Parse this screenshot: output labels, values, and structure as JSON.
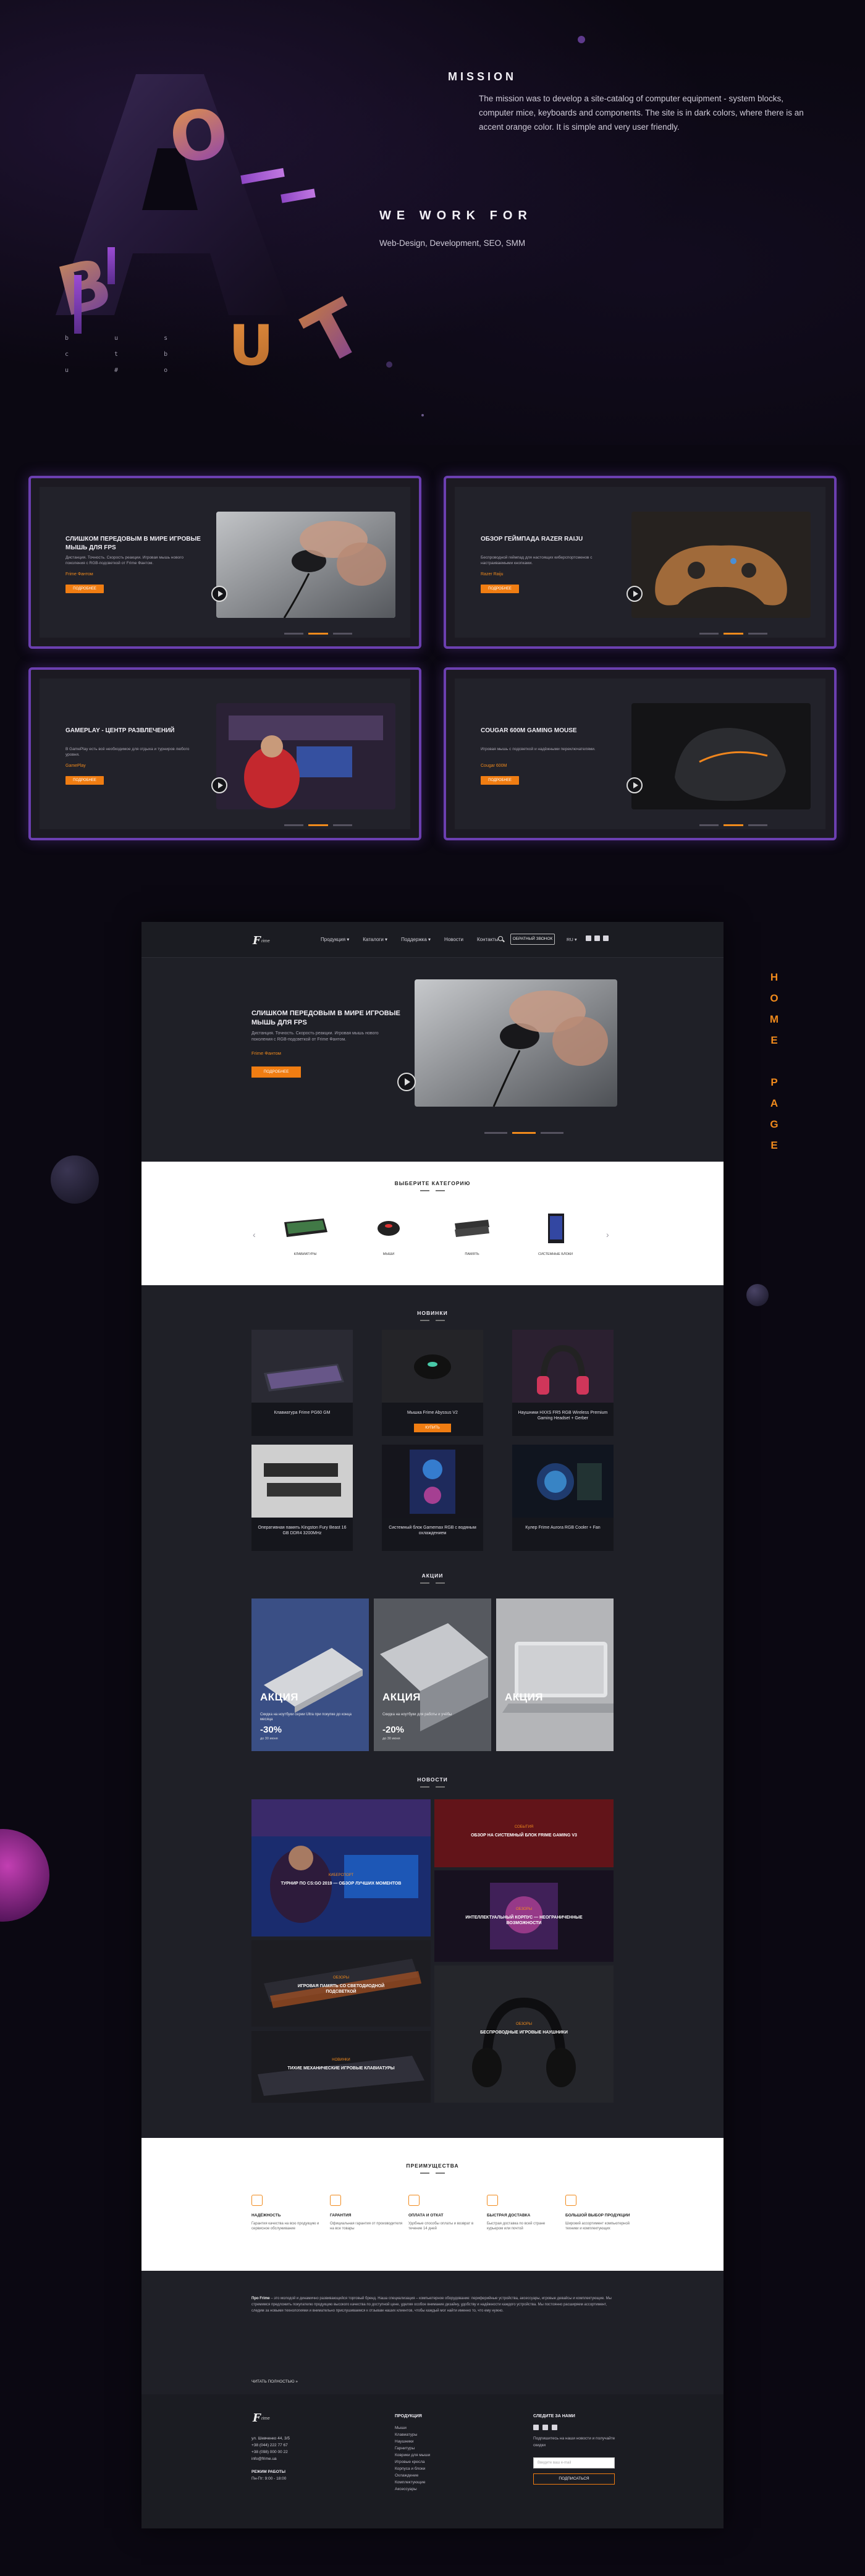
{
  "about": {
    "letters": {
      "o": "O",
      "b": "B",
      "u": "U",
      "t": "T",
      "a": "A"
    },
    "grid": [
      "b u s",
      "c t b",
      "u # o"
    ],
    "mission_title": "MISSION",
    "mission_text": "The mission was to develop a site-catalog of computer equipment - system blocks, computer mice, keyboards and components. The site is in dark colors, where there is an accent orange color. It is simple and very user friendly.",
    "work_title": "WE WORK FOR",
    "work_text": "Web-Design, Development, SEO, SMM"
  },
  "variants": [
    {
      "title": "СЛИШКОМ ПЕРЕДОВЫМ В МИРЕ ИГРОВЫЕ МЫШЬ ДЛЯ FPS",
      "desc": "Дистанция. Точность. Скорость реакции. Игровая мышь нового поколения с RGB-подсветкой от Frime Фантом.",
      "link": "Frime Фантом",
      "button": "ПОДРОБНЕЕ"
    },
    {
      "title": "ОБЗОР ГЕЙМПАДА RAZER RAIJU",
      "desc": "Беспроводной геймпад для настоящих киберспортсменов с настраиваемыми кнопками.",
      "link": "Razer Raiju",
      "button": "ПОДРОБНЕЕ"
    },
    {
      "title": "GAMEPLAY - ЦЕНТР РАЗВЛЕЧЕНИЙ",
      "desc": "В GamePlay есть всё необходимое для отдыха и турниров любого уровня.",
      "link": "GamePlay",
      "button": "ПОДРОБНЕЕ"
    },
    {
      "title": "COUGAR 600M GAMING MOUSE",
      "desc": "Игровая мышь с подсветкой и надёжными переключателями.",
      "link": "Cougar 600M",
      "button": "ПОДРОБНЕЕ"
    }
  ],
  "home_label": [
    "H",
    "O",
    "M",
    "E",
    "",
    "P",
    "A",
    "G",
    "E"
  ],
  "site": {
    "nav": {
      "logo": "F",
      "logo_word": "rime",
      "links": [
        "Продукция ▾",
        "Каталоги ▾",
        "Поддержка ▾",
        "Новости",
        "Контакты"
      ],
      "cta": "ОБРАТНЫЙ ЗВОНОК",
      "lang": "RU ▾"
    },
    "hero": {
      "title": "СЛИШКОМ ПЕРЕДОВЫМ В МИРЕ ИГРОВЫЕ МЫШЬ ДЛЯ FPS",
      "desc": "Дистанция. Точность. Скорость реакции. Игровая мышь нового поколения с RGB-подсветкой от Frime Фантом.",
      "link": "Frime Фантом",
      "button": "ПОДРОБНЕЕ"
    },
    "categories": {
      "title": "ВЫБЕРИТЕ КАТЕГОРИЮ",
      "items": [
        "КЛАВИАТУРЫ",
        "МЫШИ",
        "ПАМЯТЬ",
        "СИСТЕМНЫЕ БЛОКИ"
      ]
    },
    "novelty": {
      "title": "НОВИНКИ",
      "items": [
        "Клавиатура Frime PG60 GM",
        "Мышка Frime Abyssus V2",
        "Наушники HXXS FR5 RGB Wireless Premium Gaming Headset + Gerber",
        "Оперативная память Kingston Fury Beast 16 GB DDR4 3200MHz",
        "Системный блок Gamemax RGB с водяным охлаждением",
        "Кулер Frime Aurora RGB Cooler + Fan"
      ],
      "button": "КУПИТЬ"
    },
    "promos": {
      "title": "АКЦИИ",
      "items": [
        {
          "label": "АКЦИЯ",
          "sub": "Скидка на ноутбуки серии Ultra при покупке до конца месяца",
          "pct": "-30%",
          "date": "до 30 июня"
        },
        {
          "label": "АКЦИЯ",
          "sub": "Скидка на ноутбуки для работы и учёбы",
          "pct": "-20%",
          "date": "до 30 июня"
        },
        {
          "label": "АКЦИЯ",
          "sub": "",
          "pct": "",
          "date": ""
        }
      ]
    },
    "news": {
      "title": "НОВОСТИ",
      "items": [
        {
          "tag": "КИБЕРСПОРТ",
          "cap": "ТУРНИР ПО CS:GO 2019 — ОБЗОР ЛУЧШИХ МОМЕНТОВ"
        },
        {
          "tag": "СОБЫТИЯ",
          "cap": "ОБЗОР НА СИСТЕМНЫЙ БЛОК FRIME GAMING V3"
        },
        {
          "tag": "ОБЗОРЫ",
          "cap": "ИНТЕЛЛЕКТУАЛЬНЫЙ КОРПУС — НЕОГРАНИЧЕННЫЕ ВОЗМОЖНОСТИ"
        },
        {
          "tag": "ОБЗОРЫ",
          "cap": "ИГРОВАЯ ПАМЯТЬ СО СВЕТОДИОДНОЙ ПОДСВЕТКОЙ"
        },
        {
          "tag": "ОБЗОРЫ",
          "cap": "БЕСПРОВОДНЫЕ ИГРОВЫЕ НАУШНИКИ"
        },
        {
          "tag": "НОВИНКИ",
          "cap": "ТИХИЕ МЕХАНИЧЕСКИЕ ИГРОВЫЕ КЛАВИАТУРЫ"
        }
      ]
    },
    "advantages": {
      "title": "ПРЕИМУЩЕСТВА",
      "items": [
        {
          "title": "НАДЁЖНОСТЬ",
          "text": "Гарантия качества на всю продукцию и сервисное обслуживание"
        },
        {
          "title": "ГАРАНТИЯ",
          "text": "Официальная гарантия от производителя на все товары"
        },
        {
          "title": "ОПЛАТА И ОТКАТ",
          "text": "Удобные способы оплаты и возврат в течение 14 дней"
        },
        {
          "title": "БЫСТРАЯ ДОСТАВКА",
          "text": "Быстрая доставка по всей стране курьером или почтой"
        },
        {
          "title": "БОЛЬШОЙ ВЫБОР ПРОДУКЦИИ",
          "text": "Широкий ассортимент компьютерной техники и комплектующих"
        }
      ]
    },
    "about": {
      "brand": "Про Frime",
      "text": "– это молодой и динамично развивающийся торговый бренд. Наша специализация – компьютерное оборудование: периферийные устройства, аксессуары, игровые девайсы и комплектующие. Мы стремимся предложить покупателю продукцию высокого качества по доступной цене, уделяя особое внимание дизайну, удобству и надёжности каждого устройства. Мы постоянно расширяем ассортимент, следим за новыми технологиями и внимательно прислушиваемся к отзывам наших клиентов, чтобы каждый мог найти именно то, что ему нужно.",
      "more": "ЧИТАТЬ ПОЛНОСТЬЮ »"
    },
    "footer": {
      "contacts": [
        "ул. Шевченко 44, 3/5",
        "+38 (044) 222 77 67",
        "+38 (098) 000 00 22",
        "info@frime.ua"
      ],
      "hours_title": "РЕЖИМ РАБОТЫ",
      "hours": "Пн-Пт: 9:00 - 18:00",
      "products_title": "ПРОДУКЦИЯ",
      "products": [
        "Мыши",
        "Клавиатуры",
        "Наушники",
        "Гарнитуры",
        "Коврики для мыши",
        "Игровые кресла",
        "Корпуса и блоки",
        "Охлаждение",
        "Комплектующие",
        "Аксессуары"
      ],
      "subscribe_title": "СЛЕДИТЕ ЗА НАМИ",
      "subscribe_text": "Подпишитесь на наши новости и получайте скидки",
      "email_placeholder": "Введите ваш e-mail",
      "subscribe_button": "ПОДПИСАТЬСЯ"
    }
  },
  "colors": {
    "accent": "#f07d12",
    "purple": "#6b3fb0",
    "bg": "#0b0812",
    "panel": "#1f2027"
  }
}
